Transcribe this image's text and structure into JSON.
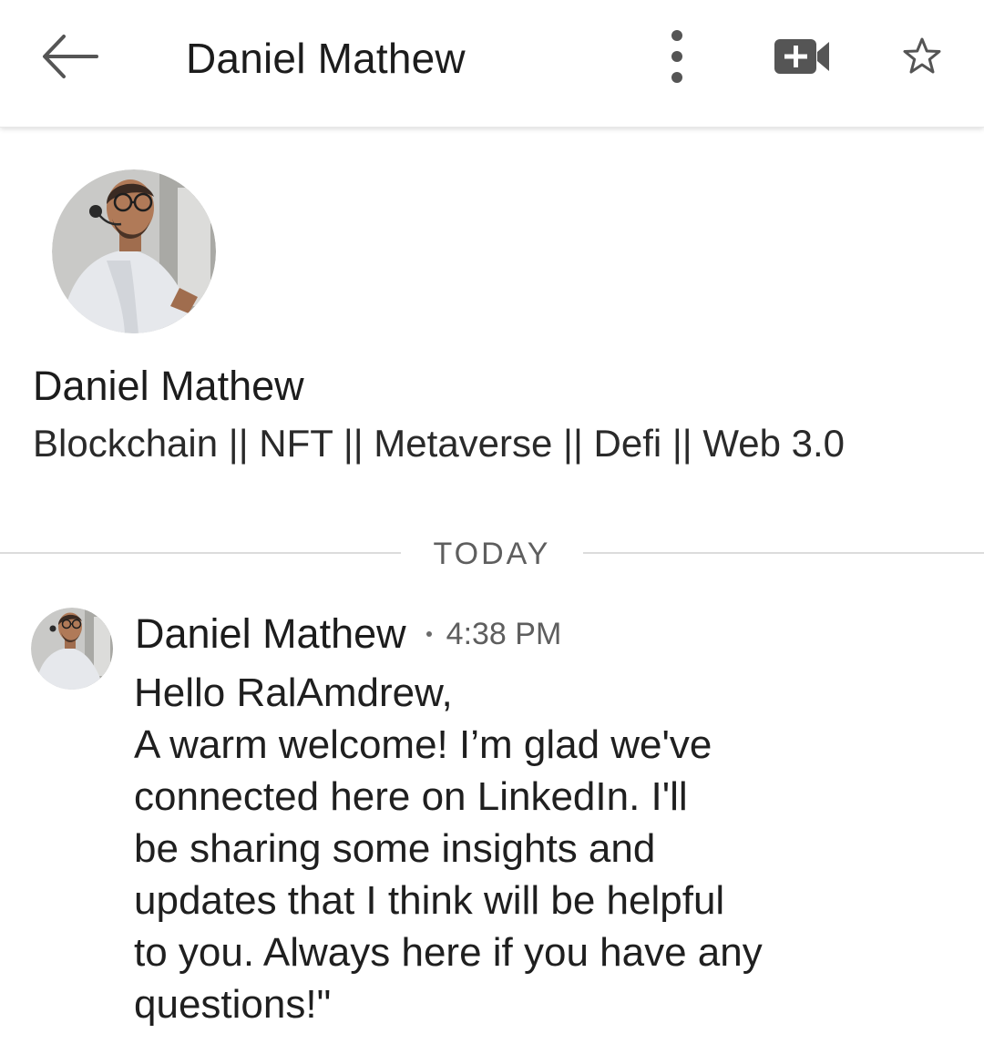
{
  "app_bar": {
    "title": "Daniel Mathew",
    "icons": [
      "back-arrow-icon",
      "more-vertical-icon",
      "video-call-add-icon",
      "star-outline-icon"
    ]
  },
  "profile": {
    "name": "Daniel Mathew",
    "headline": "Blockchain || NFT || Metaverse || Defi || Web 3.0"
  },
  "divider": {
    "label": "TODAY"
  },
  "message": {
    "sender": "Daniel Mathew",
    "time": "4:38 PM",
    "lines": [
      "Hello RalAmdrew,",
      "A warm welcome! I’m glad we've",
      "connected here on LinkedIn. I'll",
      "be sharing some insights and",
      "updates that I think will be helpful",
      "to you. Always here if you have any",
      "questions!\""
    ]
  },
  "colors": {
    "text_primary": "#1c1c1c",
    "text_secondary": "#5e5e5e",
    "icon": "#555555",
    "divider": "#dcdcdc",
    "background": "#ffffff"
  }
}
